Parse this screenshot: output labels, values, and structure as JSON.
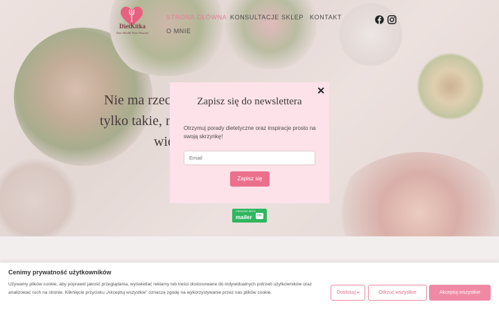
{
  "brand": {
    "name": "DietKitka",
    "tagline": "Your Health Your Passion",
    "heart_color": "#e7607f"
  },
  "nav": {
    "items": [
      {
        "label": "STRONA GŁÓWNA",
        "active": true
      },
      {
        "label": "KONSULTACJE",
        "active": false
      },
      {
        "label": "SKLEP",
        "active": false
      },
      {
        "label": "KONTAKT",
        "active": false
      },
      {
        "label": "O MNIE",
        "active": false
      }
    ]
  },
  "social": {
    "icons": [
      "facebook-icon",
      "instagram-icon"
    ]
  },
  "hero": {
    "lines": [
      "Nie ma rzecz",
      "tylko takie, n",
      "wię"
    ]
  },
  "newsletter_modal": {
    "close_symbol": "✕",
    "title": "Zapisz się do newslettera",
    "description": "Otrzymuj porady dietetyczne oraz inspiracje prosto na swoją skrzynkę!",
    "email_placeholder": "Email",
    "submit_label": "Zapisz się",
    "accent_color": "#ec6f8c",
    "background_color": "#fde2ea"
  },
  "mailerlite_badge": {
    "top_text": "CREATED WITH",
    "main_text": "mailer",
    "lite_text": "lite",
    "color": "#2eb65f"
  },
  "cookie_bar": {
    "title": "Cenimy prywatność użytkowników",
    "text": "Używamy plików cookie, aby poprawić jakość przeglądania, wyświetlać reklamy lub treści dostosowane do indywidualnych potrzeb użytkowników oraz analizować ruch na stronie. Kliknięcie przycisku „Akceptuj wszystkie” oznacza zgodę na wykorzystywanie przez nas plików cookie.",
    "customize_label": "Dostosuj",
    "customize_icon": "chevron-down-icon",
    "reject_label": "Odrzuć wszystkie",
    "accept_label": "Akceptuj wszystkie",
    "accent_color": "#f08aa4"
  }
}
